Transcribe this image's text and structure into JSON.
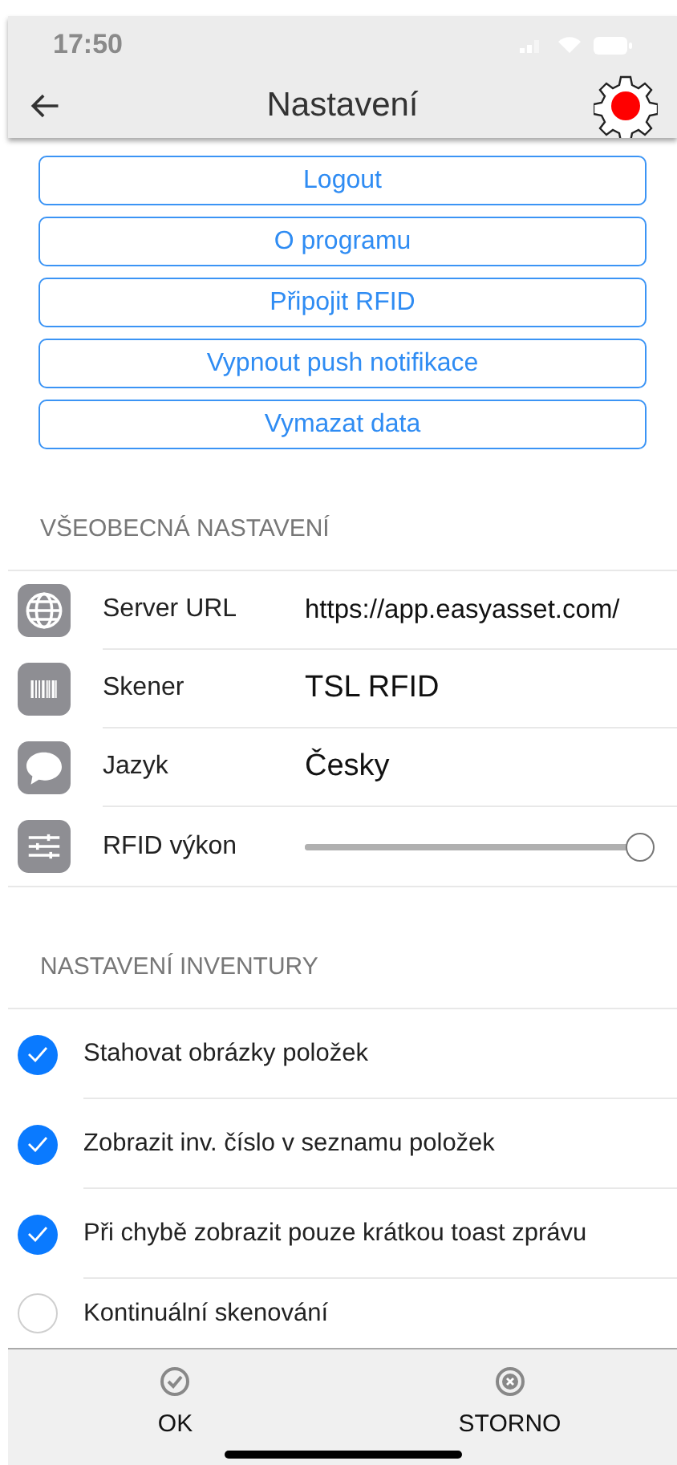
{
  "status_bar": {
    "time": "17:50"
  },
  "header": {
    "title": "Nastavení"
  },
  "action_buttons": [
    "Logout",
    "O programu",
    "Připojit RFID",
    "Vypnout push notifikace",
    "Vymazat data"
  ],
  "general_section": {
    "title": "VŠEOBECNÁ NASTAVENÍ",
    "rows": [
      {
        "kind": "text",
        "label": "Server URL",
        "value": "https://app.easyasset.com/"
      },
      {
        "kind": "text",
        "label": "Skener",
        "value": "TSL RFID"
      },
      {
        "kind": "text",
        "label": "Jazyk",
        "value": "Česky"
      },
      {
        "kind": "slider",
        "label": "RFID výkon",
        "level": 1.0
      }
    ]
  },
  "inventory_section": {
    "title": "NASTAVENÍ INVENTURY",
    "options": [
      {
        "label": "Stahovat obrázky položek",
        "checked": true
      },
      {
        "label": "Zobrazit inv. číslo v seznamu položek",
        "checked": true
      },
      {
        "label": "Při chybě zobrazit pouze krátkou toast zprávu",
        "checked": true
      },
      {
        "label": "Kontinuální skenování",
        "checked": false
      }
    ]
  },
  "footer": {
    "buttons": [
      {
        "kind": "ok",
        "label": "OK"
      },
      {
        "kind": "cancel",
        "label": "STORNO"
      }
    ]
  }
}
